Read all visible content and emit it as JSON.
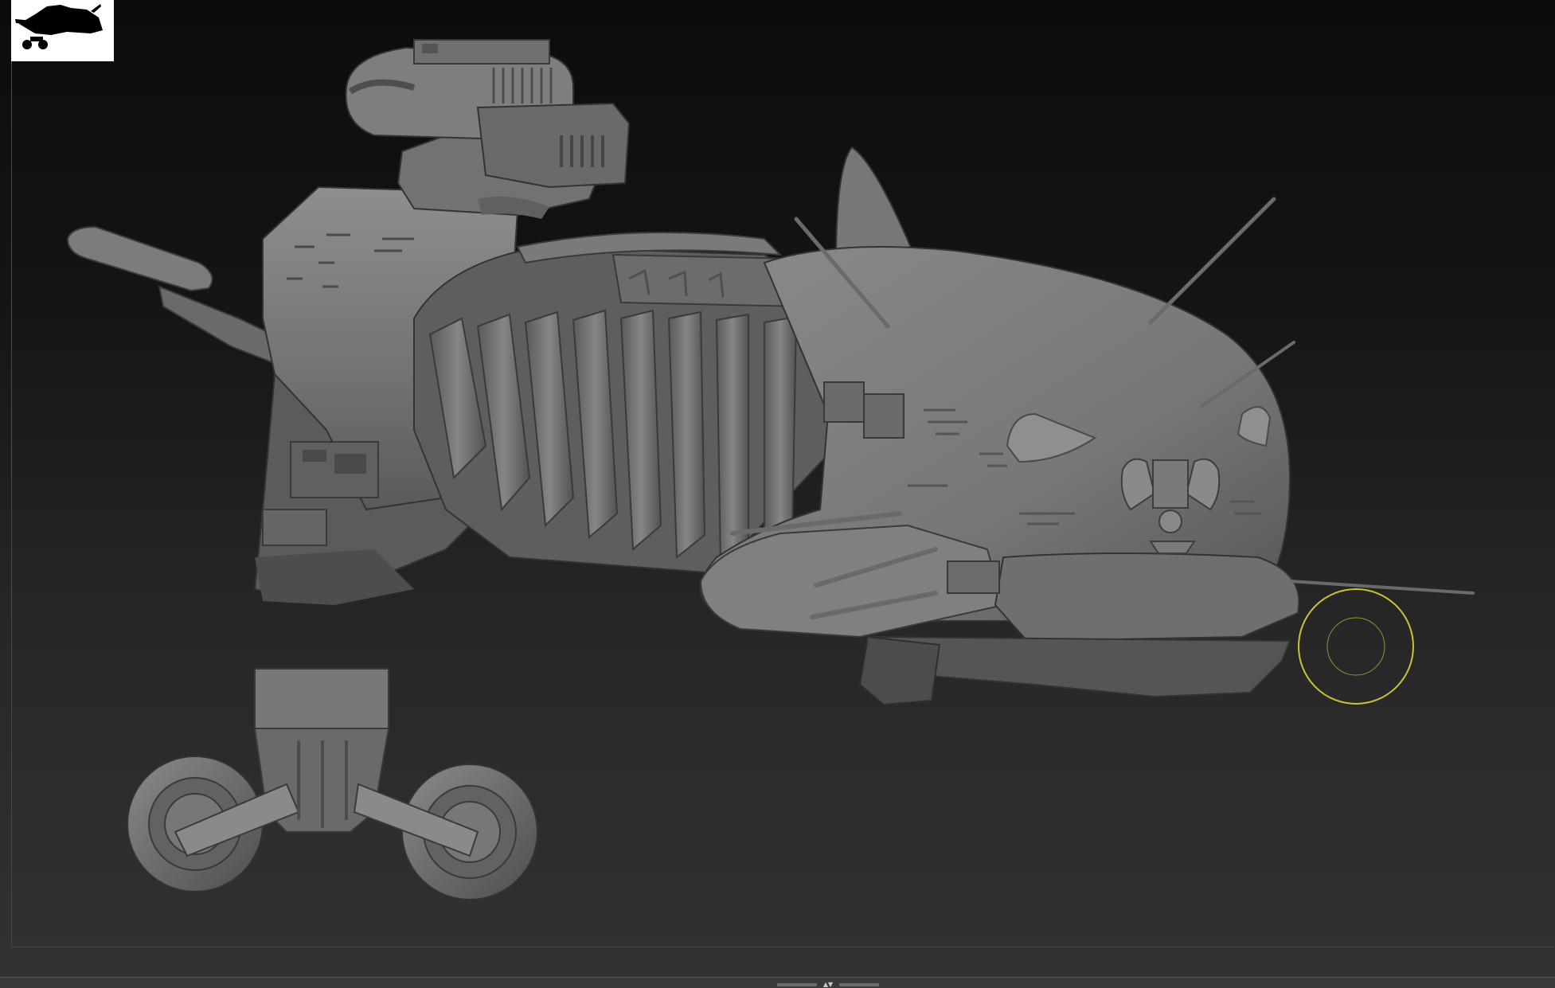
{
  "app": {
    "viewport": {
      "content": "3d-sculpt-viewport",
      "colors": {
        "background_top": "#0c0c0c",
        "background_bottom": "#323232",
        "model_base": "#6f6f6f",
        "model_highlight": "#9a9a9a",
        "model_shadow": "#3a3a3a",
        "brush_cursor": "#c9c23a"
      }
    },
    "thumbnail": {
      "icon": "model-silhouette-icon",
      "background": "#ffffff",
      "foreground": "#000000"
    },
    "bottom_tray": {
      "icon": "tray-toggle-arrows-icon",
      "glyph": "▲▼"
    }
  }
}
